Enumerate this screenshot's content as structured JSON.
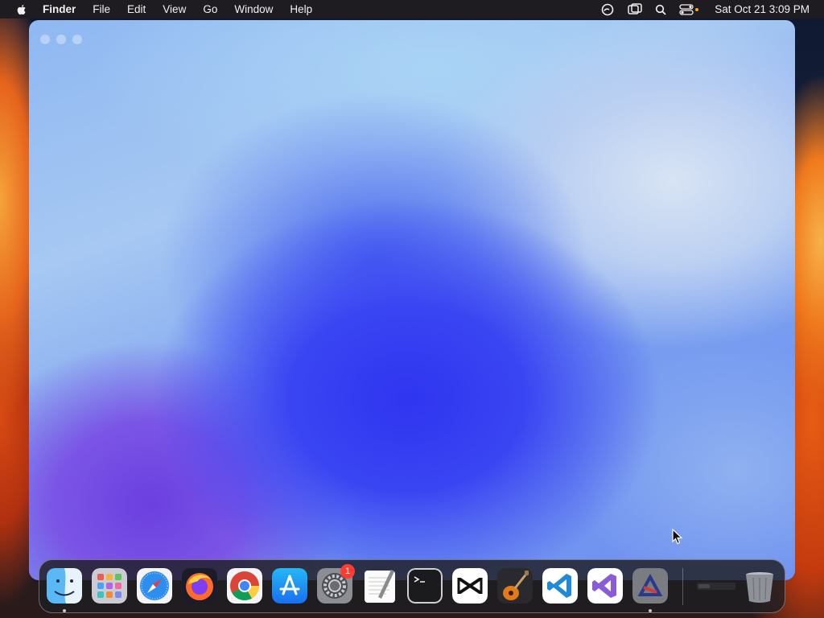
{
  "menubar": {
    "app_name": "Finder",
    "items": [
      "File",
      "Edit",
      "View",
      "Go",
      "Window",
      "Help"
    ],
    "clock": "Sat Oct 21  3:09 PM",
    "status_icons": [
      "creative-cloud-icon",
      "screen-mirroring-icon",
      "spotlight-search-icon",
      "control-center-icon"
    ]
  },
  "window": {
    "traffic_lights": [
      "close",
      "minimize",
      "zoom"
    ]
  },
  "dock": {
    "badge_count": "1",
    "apps": [
      {
        "name": "Finder",
        "icon": "finder-icon",
        "running": true
      },
      {
        "name": "Launchpad",
        "icon": "launchpad-icon",
        "running": false
      },
      {
        "name": "Safari",
        "icon": "safari-icon",
        "running": false
      },
      {
        "name": "Firefox",
        "icon": "firefox-icon",
        "running": false
      },
      {
        "name": "Google Chrome",
        "icon": "chrome-icon",
        "running": false
      },
      {
        "name": "App Store",
        "icon": "app-store-icon",
        "running": false
      },
      {
        "name": "System Settings",
        "icon": "system-settings-icon",
        "running": false
      },
      {
        "name": "TextEdit",
        "icon": "textedit-icon",
        "running": false
      },
      {
        "name": "Terminal",
        "icon": "terminal-icon",
        "running": false
      },
      {
        "name": "CapCut",
        "icon": "capcut-icon",
        "running": false
      },
      {
        "name": "GarageBand",
        "icon": "garageband-icon",
        "running": false
      },
      {
        "name": "Visual Studio Code",
        "icon": "vscode-icon",
        "running": false
      },
      {
        "name": "Visual Studio",
        "icon": "visual-studio-icon",
        "running": false
      },
      {
        "name": "Unknown App",
        "icon": "app-icon",
        "running": true
      }
    ],
    "extras": [
      {
        "name": "Minimized Window",
        "icon": "minimized-window-icon"
      },
      {
        "name": "Trash",
        "icon": "trash-icon"
      }
    ]
  },
  "colors": {
    "menubar_bg": "#1e1c20",
    "badge": "#ff3b30"
  }
}
